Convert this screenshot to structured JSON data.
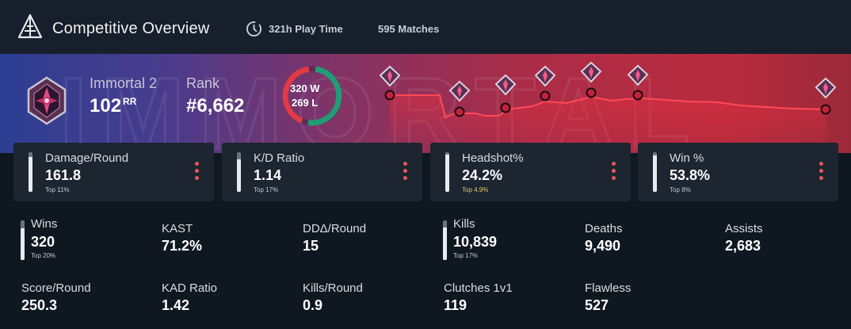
{
  "header": {
    "title": "Competitive Overview",
    "playtime": "321h Play Time",
    "matches": "595 Matches"
  },
  "banner": {
    "watermark": "IMMORTAL",
    "tier": "Immortal 2",
    "rr_value": "102",
    "rr_unit": "RR",
    "rank_label": "Rank",
    "rank_value": "#6,662",
    "wins_text": "320 W",
    "losses_text": "269 L",
    "wins": 320,
    "losses": 269,
    "colors": {
      "win": "#1f9e75",
      "loss": "#e03a45"
    }
  },
  "cards": [
    {
      "label": "Damage/Round",
      "value": "161.8",
      "sub": "Top 11%",
      "percentile": 0.89
    },
    {
      "label": "K/D Ratio",
      "value": "1.14",
      "sub": "Top 17%",
      "percentile": 0.83
    },
    {
      "label": "Headshot%",
      "value": "24.2%",
      "sub": "Top 4.9%",
      "percentile": 0.95,
      "highlight": true
    },
    {
      "label": "Win %",
      "value": "53.8%",
      "sub": "Top 8%",
      "percentile": 0.92
    }
  ],
  "stats": {
    "wins": {
      "label": "Wins",
      "value": "320",
      "sub": "Top 20%",
      "percentile": 0.8
    },
    "kast": {
      "label": "KAST",
      "value": "71.2%"
    },
    "dd": {
      "label": "DDΔ/Round",
      "value": "15"
    },
    "kills": {
      "label": "Kills",
      "value": "10,839",
      "sub": "Top 17%",
      "percentile": 0.83
    },
    "deaths": {
      "label": "Deaths",
      "value": "9,490"
    },
    "assists": {
      "label": "Assists",
      "value": "2,683"
    },
    "score": {
      "label": "Score/Round",
      "value": "250.3"
    },
    "kad": {
      "label": "KAD Ratio",
      "value": "1.42"
    },
    "kpr": {
      "label": "Kills/Round",
      "value": "0.9"
    },
    "clutches": {
      "label": "Clutches 1v1",
      "value": "119"
    },
    "flawless": {
      "label": "Flawless",
      "value": "527"
    }
  },
  "rank_history_icons": [
    "immortal-rank-icon",
    "immortal-rank-icon",
    "immortal-rank-icon",
    "immortal-rank-icon",
    "immortal-rank-icon",
    "immortal-rank-icon",
    "immortal-rank-icon"
  ]
}
